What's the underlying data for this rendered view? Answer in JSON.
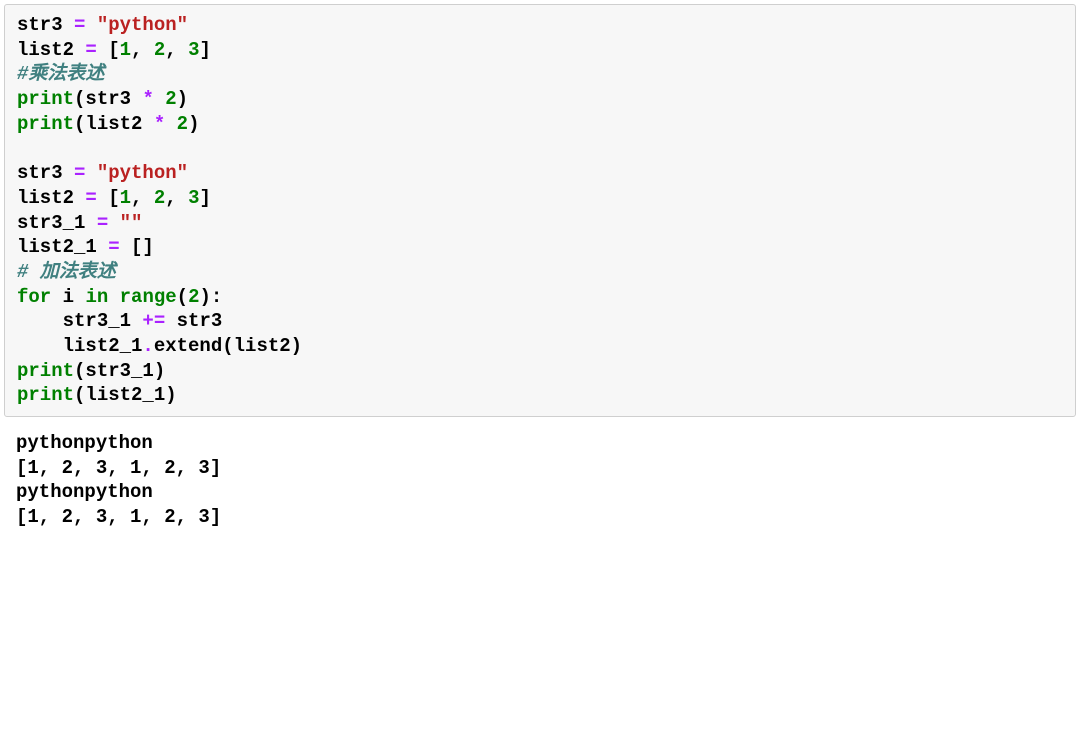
{
  "code": {
    "l1": {
      "a": "str3 ",
      "b": "=",
      "c": " ",
      "d": "\"python\""
    },
    "l2": {
      "a": "list2 ",
      "b": "=",
      "c": " [",
      "d": "1",
      "e": ", ",
      "f": "2",
      "g": ", ",
      "h": "3",
      "i": "]"
    },
    "l3": "#乘法表述",
    "l4": {
      "a": "print",
      "b": "(str3 ",
      "c": "*",
      "d": " ",
      "e": "2",
      "f": ")"
    },
    "l5": {
      "a": "print",
      "b": "(list2 ",
      "c": "*",
      "d": " ",
      "e": "2",
      "f": ")"
    },
    "l6": "",
    "l7": {
      "a": "str3 ",
      "b": "=",
      "c": " ",
      "d": "\"python\""
    },
    "l8": {
      "a": "list2 ",
      "b": "=",
      "c": " [",
      "d": "1",
      "e": ", ",
      "f": "2",
      "g": ", ",
      "h": "3",
      "i": "]"
    },
    "l9": {
      "a": "str3_1 ",
      "b": "=",
      "c": " ",
      "d": "\"\""
    },
    "l10": {
      "a": "list2_1 ",
      "b": "=",
      "c": " []"
    },
    "l11": "# 加法表述",
    "l12": {
      "a": "for",
      "b": " i ",
      "c": "in",
      "d": " ",
      "e": "range",
      "f": "(",
      "g": "2",
      "h": "):"
    },
    "l13": {
      "a": "    str3_1 ",
      "b": "+=",
      "c": " str3"
    },
    "l14": {
      "a": "    list2_1",
      "b": ".",
      "c": "extend(list2)"
    },
    "l15": {
      "a": "print",
      "b": "(str3_1)"
    },
    "l16": {
      "a": "print",
      "b": "(list2_1)"
    }
  },
  "output": {
    "o1": "pythonpython",
    "o2": "[1, 2, 3, 1, 2, 3]",
    "o3": "pythonpython",
    "o4": "[1, 2, 3, 1, 2, 3]"
  }
}
